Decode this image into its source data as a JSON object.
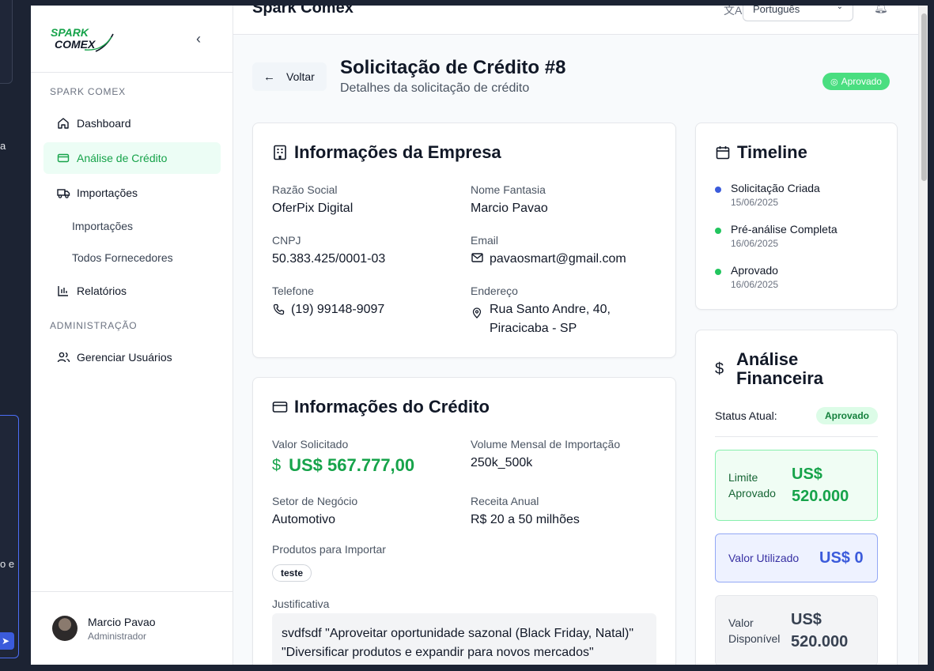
{
  "background": {
    "left_text_a": "a",
    "left_text_b": "o e"
  },
  "sidebar": {
    "brand": {
      "line1": "SPARK",
      "line2": "COMEX",
      "logo_color": "#16a34a"
    },
    "section_main": "SPARK COMEX",
    "items": [
      {
        "label": "Dashboard",
        "icon": "home-icon"
      },
      {
        "label": "Análise de Crédito",
        "icon": "credit-card-icon",
        "active": true
      },
      {
        "label": "Importações",
        "icon": "truck-icon"
      }
    ],
    "sub_items": [
      {
        "label": "Importações"
      },
      {
        "label": "Todos Fornecedores"
      }
    ],
    "reports": {
      "label": "Relatórios",
      "icon": "bar-chart-icon"
    },
    "section_admin": "ADMINISTRAÇÃO",
    "admin_items": [
      {
        "label": "Gerenciar Usuários",
        "icon": "users-icon"
      }
    ],
    "user": {
      "name": "Marcio Pavao",
      "role": "Administrador"
    }
  },
  "topbar": {
    "title": "Spark Comex",
    "language": "Português"
  },
  "header": {
    "back_label": "Voltar",
    "title": "Solicitação de Crédito #8",
    "subtitle": "Detalhes da solicitação de crédito",
    "status": "Aprovado",
    "status_color": "#4ade80"
  },
  "company": {
    "title": "Informações da Empresa",
    "razao_label": "Razão Social",
    "razao": "OferPix Digital",
    "fantasia_label": "Nome Fantasia",
    "fantasia": "Marcio Pavao",
    "cnpj_label": "CNPJ",
    "cnpj": "50.383.425/0001-03",
    "email_label": "Email",
    "email": "pavaosmart@gmail.com",
    "phone_label": "Telefone",
    "phone": "(19) 99148-9097",
    "address_label": "Endereço",
    "address_line1": "Rua Santo Andre, 40,",
    "address_line2": "Piracicaba - SP"
  },
  "credit": {
    "title": "Informações do Crédito",
    "amount_label": "Valor Solicitado",
    "amount": "US$ 567.777,00",
    "volume_label": "Volume Mensal de Importação",
    "volume": "250k_500k",
    "sector_label": "Setor de Negócio",
    "sector": "Automotivo",
    "revenue_label": "Receita Anual",
    "revenue": "R$ 20 a 50 milhões",
    "products_label": "Produtos para Importar",
    "products": [
      "teste"
    ],
    "justification_label": "Justificativa",
    "justification": "svdfsdf \"Aproveitar oportunidade sazonal (Black Friday, Natal)\" \"Diversificar produtos e expandir para novos mercados\""
  },
  "timeline": {
    "title": "Timeline",
    "events": [
      {
        "title": "Solicitação Criada",
        "date": "15/06/2025",
        "color": "#3b5bdb"
      },
      {
        "title": "Pré-análise Completa",
        "date": "16/06/2025",
        "color": "#22c55e"
      },
      {
        "title": "Aprovado",
        "date": "16/06/2025",
        "color": "#22c55e"
      }
    ]
  },
  "financial": {
    "title_line1": "Análise",
    "title_line2": "Financeira",
    "status_label": "Status Atual:",
    "status": "Aprovado",
    "limit_label_1": "Limite",
    "limit_label_2": "Aprovado",
    "limit_value_1": "US$",
    "limit_value_2": "520.000",
    "used_label": "Valor Utilizado",
    "used_value": "US$ 0",
    "available_label_1": "Valor",
    "available_label_2": "Disponível",
    "available_value_1": "US$",
    "available_value_2": "520.000"
  }
}
